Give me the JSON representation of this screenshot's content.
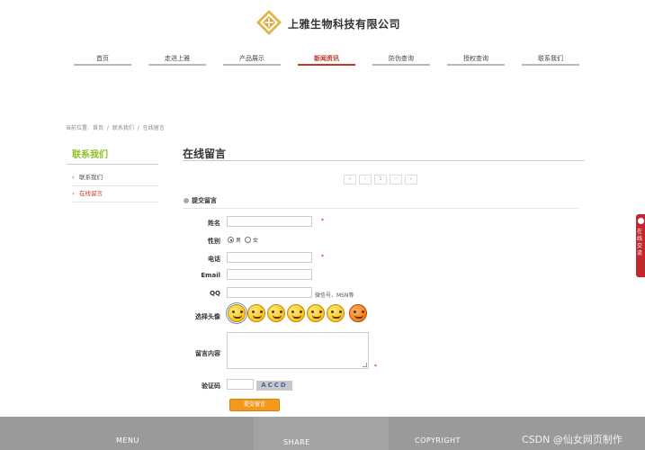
{
  "header": {
    "company_name": "上雅生物科技有限公司",
    "brand_color": "#d4a63a"
  },
  "nav": {
    "items": [
      {
        "label": "首页",
        "active": false
      },
      {
        "label": "走进上雅",
        "active": false
      },
      {
        "label": "产品展示",
        "active": false
      },
      {
        "label": "新闻资讯",
        "active": true
      },
      {
        "label": "防伪查询",
        "active": false
      },
      {
        "label": "授权查询",
        "active": false
      },
      {
        "label": "联系我们",
        "active": false
      }
    ],
    "active_color": "#c0392b"
  },
  "breadcrumb": {
    "prefix": "当前位置:",
    "items": [
      "首页",
      "/",
      "联系我们",
      "/",
      "在线留言"
    ]
  },
  "sidebar": {
    "title": "联系我们",
    "title_color": "#8cbf26",
    "items": [
      {
        "label": "联系我们",
        "active": false
      },
      {
        "label": "在线留言",
        "active": true
      }
    ]
  },
  "main": {
    "title": "在线留言",
    "pager": [
      "«",
      "‹",
      "1",
      "›",
      "»"
    ],
    "section_title": "提交留言"
  },
  "form": {
    "name_label": "姓名",
    "name_required": "*",
    "gender_label": "性别",
    "gender_options": [
      "男",
      "女"
    ],
    "gender_selected": "男",
    "phone_label": "电话",
    "phone_required": "*",
    "email_label": "Email",
    "qq_label": "QQ",
    "qq_hint": "微信号、MSN等",
    "avatar_label": "选择头像",
    "content_label": "留言内容",
    "content_required": "*",
    "captcha_label": "验证码",
    "captcha_image_text": "ACCD",
    "submit_label": "提交留言",
    "submit_color": "#f39a1e"
  },
  "right_tab": {
    "icon": "chat-icon",
    "text": "在线交流",
    "color": "#c1272d"
  },
  "footer": {
    "columns": [
      "MENU",
      "SHARE",
      "COPYRIGHT"
    ]
  },
  "watermark": "CSDN @仙女网页制作"
}
